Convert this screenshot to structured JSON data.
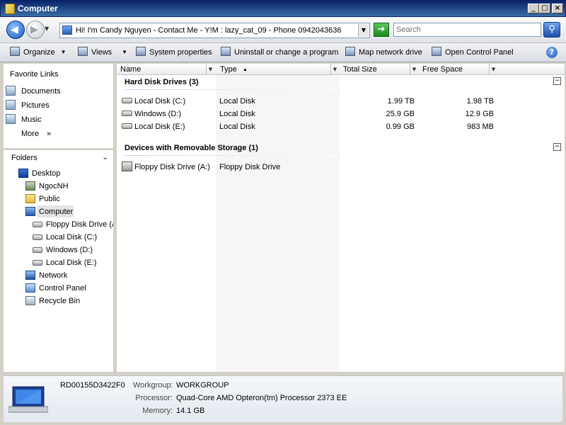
{
  "window": {
    "title": "Computer"
  },
  "address": {
    "text": "Hi! I'm Candy Nguyen - Contact Me - Y!M : lazy_cat_09 - Phone 0942043636"
  },
  "search": {
    "placeholder": "Search"
  },
  "toolbar": {
    "organize": "Organize",
    "views": "Views",
    "system_properties": "System properties",
    "uninstall": "Uninstall or change a program",
    "map_drive": "Map network drive",
    "control_panel": "Open Control Panel"
  },
  "favorites": {
    "heading": "Favorite Links",
    "items": [
      "Documents",
      "Pictures",
      "Music"
    ],
    "more": "More",
    "more_chevron": "»"
  },
  "folders": {
    "heading": "Folders",
    "tree": [
      "Desktop",
      "NgocNH",
      "Public",
      "Computer",
      "Floppy Disk Drive (A:)",
      "Local Disk (C:)",
      "Windows (D:)",
      "Local Disk (E:)",
      "Network",
      "Control Panel",
      "Recycle Bin"
    ],
    "selected": "Computer"
  },
  "columns": [
    "Name",
    "Type",
    "Total Size",
    "Free Space"
  ],
  "groups": {
    "hdd": {
      "title": "Hard Disk Drives (3)",
      "rows": [
        {
          "name": "Local Disk (C:)",
          "type": "Local Disk",
          "total": "1.99 TB",
          "free": "1.98 TB"
        },
        {
          "name": "Windows (D:)",
          "type": "Local Disk",
          "total": "25.9 GB",
          "free": "12.9 GB"
        },
        {
          "name": "Local Disk (E:)",
          "type": "Local Disk",
          "total": "0.99 GB",
          "free": "983 MB"
        }
      ]
    },
    "removable": {
      "title": "Devices with Removable Storage (1)",
      "rows": [
        {
          "name": "Floppy Disk Drive (A:)",
          "type": "Floppy Disk Drive"
        }
      ]
    }
  },
  "details": {
    "computer_name": "RD00155D3422F0",
    "workgroup_label": "Workgroup:",
    "workgroup": "WORKGROUP",
    "processor_label": "Processor:",
    "processor": "Quad-Core AMD Opteron(tm) Processor 2373 EE",
    "memory_label": "Memory:",
    "memory": "14.1 GB"
  }
}
